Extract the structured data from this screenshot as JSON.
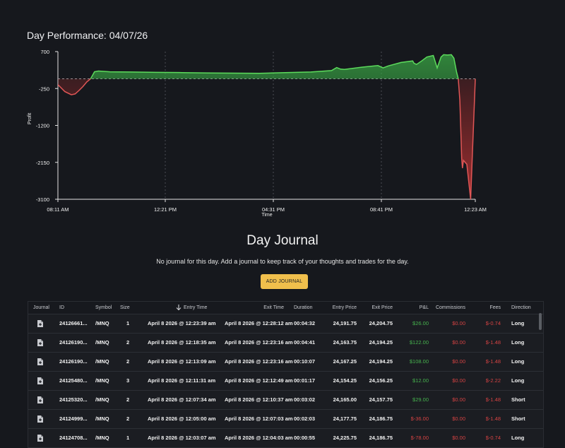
{
  "title": "Day Performance: 04/07/26",
  "chart_data": {
    "type": "area",
    "xlabel": "Time",
    "ylabel": "Profit",
    "yticks": [
      "700",
      "-250",
      "-1200",
      "-2150",
      "-3100"
    ],
    "ylim": [
      -3100,
      700
    ],
    "xticks": [
      "08:11 AM",
      "12:21 PM",
      "04:31 PM",
      "08:41 PM",
      "12:23 AM"
    ],
    "xlim_hours": [
      8.18,
      24.38
    ],
    "baseline": 0,
    "series": [
      {
        "x": [
          8.18,
          8.45,
          8.7,
          8.85,
          9.0,
          9.15,
          9.3,
          9.45,
          9.6,
          9.75,
          9.95,
          10.2,
          11.0,
          12.0,
          13.0,
          14.0,
          15.0,
          16.0,
          17.0,
          18.0,
          18.8,
          19.0,
          19.15,
          19.3,
          20.0,
          20.6,
          20.8,
          21.0,
          21.5,
          21.95,
          22.0,
          22.1,
          22.3,
          22.5,
          22.75,
          22.9,
          23.05,
          23.15,
          23.3,
          23.45,
          23.55,
          23.65,
          23.72,
          23.78,
          23.82,
          23.85,
          23.88,
          23.92,
          24.05,
          24.2,
          24.38
        ],
        "y": [
          -150,
          -330,
          -410,
          -390,
          -300,
          -200,
          -80,
          0,
          180,
          200,
          190,
          180,
          175,
          165,
          160,
          150,
          145,
          140,
          160,
          175,
          210,
          290,
          250,
          240,
          300,
          340,
          280,
          330,
          420,
          460,
          400,
          370,
          460,
          560,
          600,
          280,
          560,
          620,
          610,
          620,
          530,
          180,
          0,
          -550,
          -1400,
          -2050,
          -2300,
          -2100,
          -2200,
          -3100,
          0
        ]
      }
    ],
    "grid": true
  },
  "journal": {
    "title": "Day Journal",
    "message": "No journal for this day. Add a journal to keep track of your thoughts and trades for the day.",
    "add_button": "ADD JOURNAL"
  },
  "table": {
    "headers": {
      "journal": "Journal",
      "id": "ID",
      "symbol": "Symbol",
      "size": "Size",
      "entry_time": "Entry Time",
      "exit_time": "Exit Time",
      "duration": "Duration",
      "entry_price": "Entry Price",
      "exit_price": "Exit Price",
      "pnl": "P&L",
      "commissions": "Commissions",
      "fees": "Fees",
      "direction": "Direction"
    },
    "sort_icon": "arrow-down-icon",
    "colors": {
      "positive": "#46b24e",
      "negative": "#d64343"
    },
    "rows": [
      {
        "id": "24126661...",
        "symbol": "/MNQ",
        "size": "1",
        "entry_time": "April 8 2026 @ 12:23:39 am",
        "exit_time": "April 8 2026 @ 12:28:12 am",
        "duration": "00:04:32",
        "entry_price": "24,191.75",
        "exit_price": "24,204.75",
        "pnl": "$26.00",
        "pnl_sign": "pos",
        "commissions": "$0.00",
        "fees": "$-0.74",
        "direction": "Long"
      },
      {
        "id": "24126190...",
        "symbol": "/MNQ",
        "size": "2",
        "entry_time": "April 8 2026 @ 12:18:35 am",
        "exit_time": "April 8 2026 @ 12:23:16 am",
        "duration": "00:04:41",
        "entry_price": "24,163.75",
        "exit_price": "24,194.25",
        "pnl": "$122.00",
        "pnl_sign": "pos",
        "commissions": "$0.00",
        "fees": "$-1.48",
        "direction": "Long"
      },
      {
        "id": "24126190...",
        "symbol": "/MNQ",
        "size": "2",
        "entry_time": "April 8 2026 @ 12:13:09 am",
        "exit_time": "April 8 2026 @ 12:23:16 am",
        "duration": "00:10:07",
        "entry_price": "24,167.25",
        "exit_price": "24,194.25",
        "pnl": "$108.00",
        "pnl_sign": "pos",
        "commissions": "$0.00",
        "fees": "$-1.48",
        "direction": "Long"
      },
      {
        "id": "24125480...",
        "symbol": "/MNQ",
        "size": "3",
        "entry_time": "April 8 2026 @ 12:11:31 am",
        "exit_time": "April 8 2026 @ 12:12:49 am",
        "duration": "00:01:17",
        "entry_price": "24,154.25",
        "exit_price": "24,156.25",
        "pnl": "$12.00",
        "pnl_sign": "pos",
        "commissions": "$0.00",
        "fees": "$-2.22",
        "direction": "Long"
      },
      {
        "id": "24125320...",
        "symbol": "/MNQ",
        "size": "2",
        "entry_time": "April 8 2026 @ 12:07:34 am",
        "exit_time": "April 8 2026 @ 12:10:37 am",
        "duration": "00:03:02",
        "entry_price": "24,165.00",
        "exit_price": "24,157.75",
        "pnl": "$29.00",
        "pnl_sign": "pos",
        "commissions": "$0.00",
        "fees": "$-1.48",
        "direction": "Short"
      },
      {
        "id": "24124999...",
        "symbol": "/MNQ",
        "size": "2",
        "entry_time": "April 8 2026 @ 12:05:00 am",
        "exit_time": "April 8 2026 @ 12:07:03 am",
        "duration": "00:02:03",
        "entry_price": "24,177.75",
        "exit_price": "24,186.75",
        "pnl": "$-36.00",
        "pnl_sign": "neg",
        "commissions": "$0.00",
        "fees": "$-1.48",
        "direction": "Short"
      },
      {
        "id": "24124708...",
        "symbol": "/MNQ",
        "size": "1",
        "entry_time": "April 8 2026 @ 12:03:07 am",
        "exit_time": "April 8 2026 @ 12:04:03 am",
        "duration": "00:00:55",
        "entry_price": "24,225.75",
        "exit_price": "24,186.75",
        "pnl": "$-78.00",
        "pnl_sign": "neg",
        "commissions": "$0.00",
        "fees": "$-0.74",
        "direction": "Long"
      }
    ]
  }
}
